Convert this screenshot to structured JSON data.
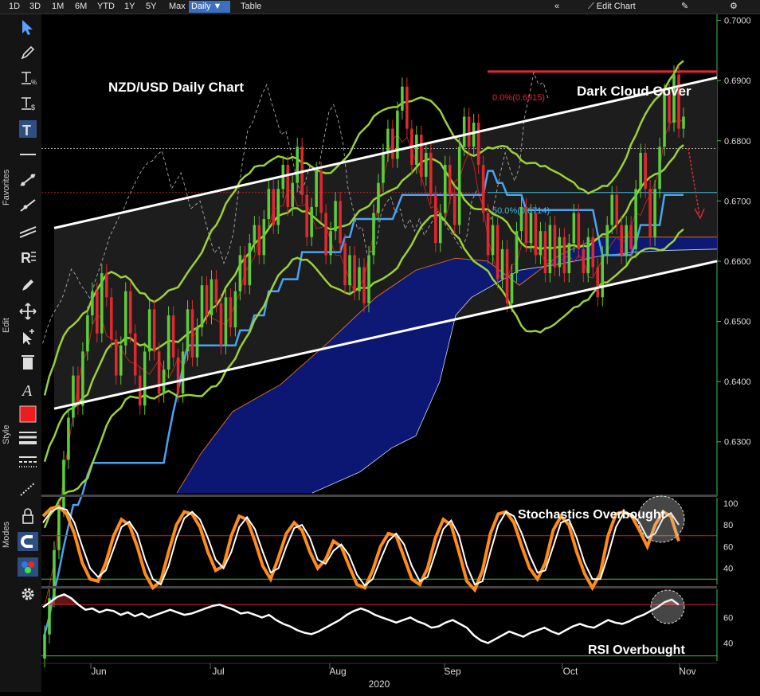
{
  "topbar": {
    "ranges": [
      "1D",
      "3D",
      "1M",
      "6M",
      "YTD",
      "1Y",
      "5Y",
      "Max"
    ],
    "frequency": "Daily",
    "table_label": "Table",
    "edit_chart_label": "Edit Chart"
  },
  "side_tabs": {
    "favorites": "Favorites",
    "edit": "Edit",
    "style": "Style",
    "modes": "Modes"
  },
  "icons": [
    "pointer-icon",
    "pencil-icon",
    "percent-line-icon",
    "dollar-line-icon",
    "text-icon",
    "horizontal-line-icon",
    "trend-line-icon",
    "ray-line-icon",
    "channel-icon",
    "annotation-icon",
    "draw-icon",
    "move-icon",
    "select-add-icon",
    "trash-icon",
    "font-icon",
    "color-swatch-icon",
    "line-weight-icon",
    "line-style-icon",
    "dotted-line-icon",
    "lock-icon",
    "magnet-icon",
    "palette-icon",
    "gear-icon"
  ],
  "colors": {
    "up": "#5ccc3c",
    "down": "#e0282e",
    "cloud": "#0d1a80",
    "bollinger": "#9bd236",
    "kijun": "#4aa3f2",
    "fib": "#e0282e",
    "fib50": "#3fbbd6",
    "stoch_k": "#ff8c1a"
  },
  "chart_data": [
    {
      "type": "candlestick",
      "title": "NZD/USD Daily Chart",
      "y_ticks": [
        "0.7000",
        "0.6900",
        "0.6800",
        "0.6700",
        "0.6600",
        "0.6500",
        "0.6400",
        "0.6300"
      ],
      "x_ticks": [
        "Jun",
        "Jul",
        "Aug",
        "Sep",
        "Oct",
        "Nov"
      ],
      "x_year": "2020",
      "ylim": [
        0.6215,
        0.701
      ],
      "annotations": {
        "pattern": "Dark Cloud Cover",
        "fib_0": "0.0%(0.6915)",
        "fib_50": "50.0%(0.6714)"
      },
      "close": [
        0.598,
        0.604,
        0.612,
        0.619,
        0.627,
        0.634,
        0.641,
        0.636,
        0.645,
        0.651,
        0.655,
        0.648,
        0.658,
        0.654,
        0.647,
        0.641,
        0.646,
        0.655,
        0.648,
        0.641,
        0.636,
        0.645,
        0.652,
        0.645,
        0.638,
        0.642,
        0.651,
        0.644,
        0.638,
        0.645,
        0.652,
        0.644,
        0.649,
        0.656,
        0.651,
        0.657,
        0.653,
        0.646,
        0.654,
        0.649,
        0.655,
        0.661,
        0.656,
        0.663,
        0.666,
        0.661,
        0.667,
        0.672,
        0.666,
        0.672,
        0.676,
        0.669,
        0.673,
        0.679,
        0.671,
        0.664,
        0.669,
        0.675,
        0.668,
        0.661,
        0.665,
        0.67,
        0.663,
        0.656,
        0.661,
        0.655,
        0.659,
        0.653,
        0.661,
        0.668,
        0.673,
        0.678,
        0.682,
        0.677,
        0.685,
        0.689,
        0.682,
        0.676,
        0.681,
        0.674,
        0.678,
        0.671,
        0.663,
        0.668,
        0.676,
        0.671,
        0.666,
        0.679,
        0.684,
        0.679,
        0.683,
        0.676,
        0.668,
        0.661,
        0.666,
        0.657,
        0.662,
        0.653,
        0.658,
        0.665,
        0.669,
        0.663,
        0.668,
        0.661,
        0.665,
        0.658,
        0.666,
        0.659,
        0.664,
        0.658,
        0.663,
        0.668,
        0.662,
        0.658,
        0.664,
        0.659,
        0.654,
        0.661,
        0.666,
        0.671,
        0.666,
        0.661,
        0.666,
        0.662,
        0.672,
        0.678,
        0.672,
        0.664,
        0.672,
        0.679,
        0.688,
        0.683,
        0.691,
        0.682,
        0.684
      ]
    },
    {
      "type": "line",
      "name": "stochastics",
      "annotation": "Stochastics Overbought",
      "y_ticks": [
        "100",
        "80",
        "60",
        "40"
      ],
      "ylim": [
        25,
        105
      ],
      "overbought": 70,
      "oversold": 30,
      "k": [
        88,
        95,
        97,
        90,
        72,
        45,
        30,
        28,
        45,
        70,
        85,
        80,
        60,
        35,
        22,
        28,
        55,
        80,
        92,
        90,
        78,
        55,
        38,
        42,
        70,
        88,
        85,
        65,
        42,
        30,
        50,
        72,
        82,
        75,
        55,
        40,
        48,
        65,
        60,
        42,
        25,
        22,
        38,
        60,
        72,
        70,
        50,
        30,
        25,
        40,
        68,
        85,
        80,
        55,
        28,
        20,
        38,
        72,
        90,
        92,
        82,
        60,
        40,
        30,
        45,
        75,
        88,
        80,
        55,
        35,
        22,
        35,
        70,
        90,
        92,
        88,
        75,
        60,
        80,
        92,
        88,
        65
      ],
      "d": [
        82,
        92,
        96,
        94,
        82,
        60,
        40,
        32,
        38,
        58,
        78,
        83,
        72,
        48,
        30,
        25,
        42,
        68,
        86,
        92,
        85,
        68,
        48,
        40,
        55,
        78,
        87,
        76,
        55,
        36,
        40,
        60,
        77,
        80,
        68,
        48,
        44,
        56,
        62,
        52,
        34,
        24,
        30,
        48,
        65,
        72,
        62,
        42,
        28,
        32,
        54,
        76,
        84,
        70,
        42,
        25,
        28,
        55,
        80,
        92,
        88,
        72,
        52,
        36,
        38,
        60,
        82,
        85,
        68,
        45,
        30,
        30,
        52,
        78,
        91,
        90,
        82,
        68,
        72,
        86,
        91,
        80
      ]
    },
    {
      "type": "line",
      "name": "RSI",
      "annotation": "RSI Overbought",
      "y_ticks": [
        "60",
        "40"
      ],
      "ylim": [
        26,
        82
      ],
      "overbought": 70,
      "oversold": 30,
      "values": [
        68,
        72,
        76,
        78,
        75,
        70,
        66,
        67,
        64,
        66,
        65,
        62,
        64,
        61,
        63,
        60,
        62,
        64,
        66,
        64,
        62,
        63,
        65,
        67,
        69,
        70,
        68,
        66,
        63,
        64,
        62,
        60,
        62,
        58,
        55,
        53,
        50,
        48,
        47,
        49,
        52,
        55,
        58,
        62,
        65,
        67,
        65,
        62,
        60,
        58,
        56,
        58,
        60,
        57,
        55,
        52,
        53,
        56,
        58,
        55,
        52,
        46,
        42,
        40,
        43,
        46,
        49,
        47,
        45,
        48,
        50,
        52,
        49,
        47,
        50,
        53,
        55,
        53,
        52,
        55,
        58,
        56,
        55,
        57,
        60,
        62,
        65,
        68,
        72,
        74,
        70
      ]
    }
  ]
}
